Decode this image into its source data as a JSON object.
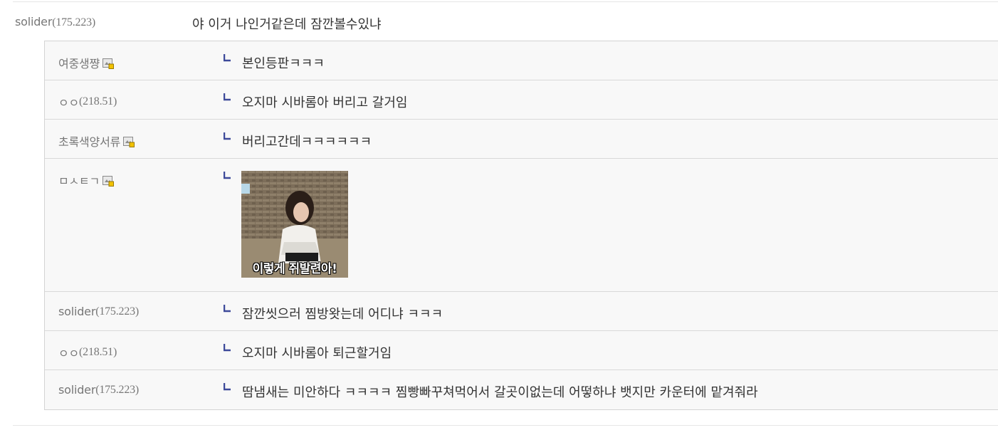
{
  "main_comment": {
    "author": "solider",
    "ip": "(175.223)",
    "text": "야 이거 나인거같은데 잠깐볼수있냐"
  },
  "replies": [
    {
      "author": "여중생쨩",
      "ip": "",
      "has_badge": true,
      "text": "본인등판ㅋㅋㅋ"
    },
    {
      "author": "ㅇㅇ",
      "ip": "(218.51)",
      "has_badge": false,
      "text": "오지마 시바롬아 버리고 갈거임"
    },
    {
      "author": "초록색양서류",
      "ip": "",
      "has_badge": true,
      "text": "버리고간데ㅋㅋㅋㅋㅋㅋ"
    },
    {
      "author": "ㅁㅅㅌㄱ",
      "ip": "",
      "has_badge": true,
      "image_caption": "이렇게 쥐발련아!"
    },
    {
      "author": "solider",
      "ip": "(175.223)",
      "has_badge": false,
      "text": "잠깐씻으러 찜방왓는데 어디냐 ㅋㅋㅋ"
    },
    {
      "author": "ㅇㅇ",
      "ip": "(218.51)",
      "has_badge": false,
      "text": "오지마 시바롬아 퇴근할거임"
    },
    {
      "author": "solider",
      "ip": "(175.223)",
      "has_badge": false,
      "text": "땀냄새는 미안하다 ㅋㅋㅋㅋ 찜빵빠꾸쳐먹어서 갈곳이없는데 어떻하냐 뱃지만 카운터에 맡겨줘라"
    }
  ],
  "colors": {
    "reply_arrow": "#3d4a9a",
    "reply_bg": "#f8f8f8",
    "border": "#d4d4d4"
  }
}
